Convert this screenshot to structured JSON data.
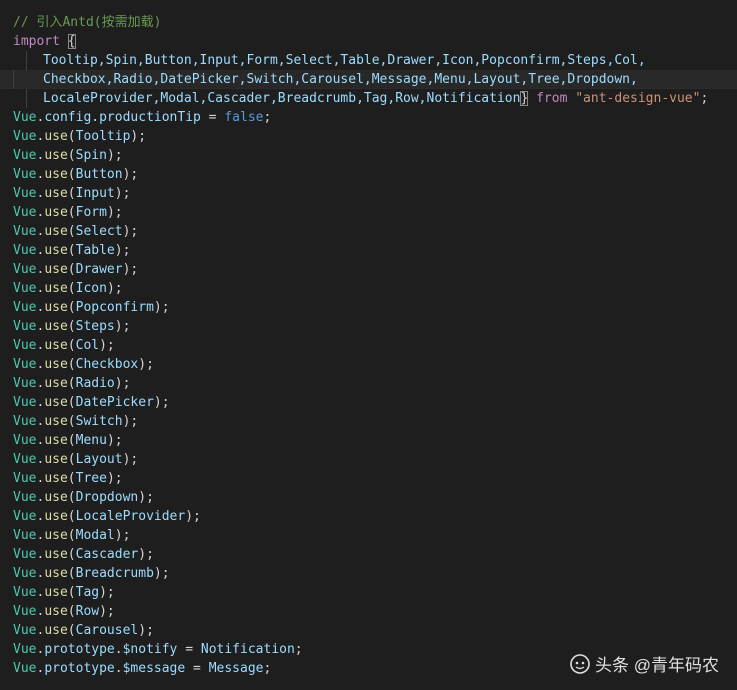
{
  "comment": "// 引入Antd(按需加载)",
  "import_kw": "import",
  "open_brace": "{",
  "close_brace": "}",
  "import_line1": "Tooltip,Spin,Button,Input,Form,Select,Table,Drawer,Icon,Popconfirm,Steps,Col,",
  "import_line2": "Checkbox,Radio,DatePicker,Switch,Carousel,Message,Menu,Layout,Tree,Dropdown,",
  "import_line3": "LocaleProvider,Modal,Cascader,Breadcrumb,Tag,Row,Notification",
  "from_kw": "from",
  "module": "\"ant-design-vue\"",
  "semicolon": ";",
  "config_line": {
    "obj": "Vue",
    "dot1": ".",
    "prop1": "config",
    "dot2": ".",
    "prop2": "productionTip",
    "eq": " = ",
    "val": "false",
    "end": ";"
  },
  "use_calls": [
    "Tooltip",
    "Spin",
    "Button",
    "Input",
    "Form",
    "Select",
    "Table",
    "Drawer",
    "Icon",
    "Popconfirm",
    "Steps",
    "Col",
    "Checkbox",
    "Radio",
    "DatePicker",
    "Switch",
    "Menu",
    "Layout",
    "Tree",
    "Dropdown",
    "LocaleProvider",
    "Modal",
    "Cascader",
    "Breadcrumb",
    "Tag",
    "Row",
    "Carousel"
  ],
  "vue": "Vue",
  "use_fn": "use",
  "prototype_lines": [
    {
      "prop": "$notify",
      "value": "Notification"
    },
    {
      "prop": "$message",
      "value": "Message"
    }
  ],
  "prototype_kw": "prototype",
  "watermark": {
    "text": "头条 @青年码农",
    "icon": "toutiao-logo-icon"
  }
}
